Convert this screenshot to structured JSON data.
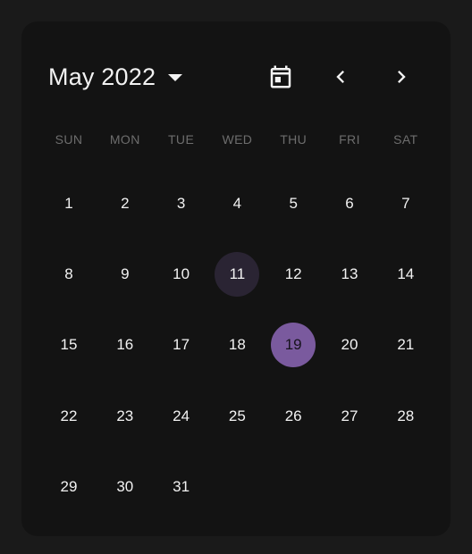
{
  "calendar": {
    "month_label": "May 2022",
    "weekdays": [
      "SUN",
      "MON",
      "TUE",
      "WED",
      "THU",
      "FRI",
      "SAT"
    ],
    "start_offset": 0,
    "days": [
      "1",
      "2",
      "3",
      "4",
      "5",
      "6",
      "7",
      "8",
      "9",
      "10",
      "11",
      "12",
      "13",
      "14",
      "15",
      "16",
      "17",
      "18",
      "19",
      "20",
      "21",
      "22",
      "23",
      "24",
      "25",
      "26",
      "27",
      "28",
      "29",
      "30",
      "31"
    ],
    "today": "11",
    "selected": "19",
    "icons": {
      "calendar": "calendar-today-icon",
      "prev": "chevron-left-icon",
      "next": "chevron-right-icon",
      "month_dropdown": "caret-down-icon"
    },
    "colors": {
      "selected_bg": "#7a5a9e",
      "today_bg": "#2a2433",
      "card_bg": "#131313",
      "page_bg": "#1a1a1a"
    }
  }
}
